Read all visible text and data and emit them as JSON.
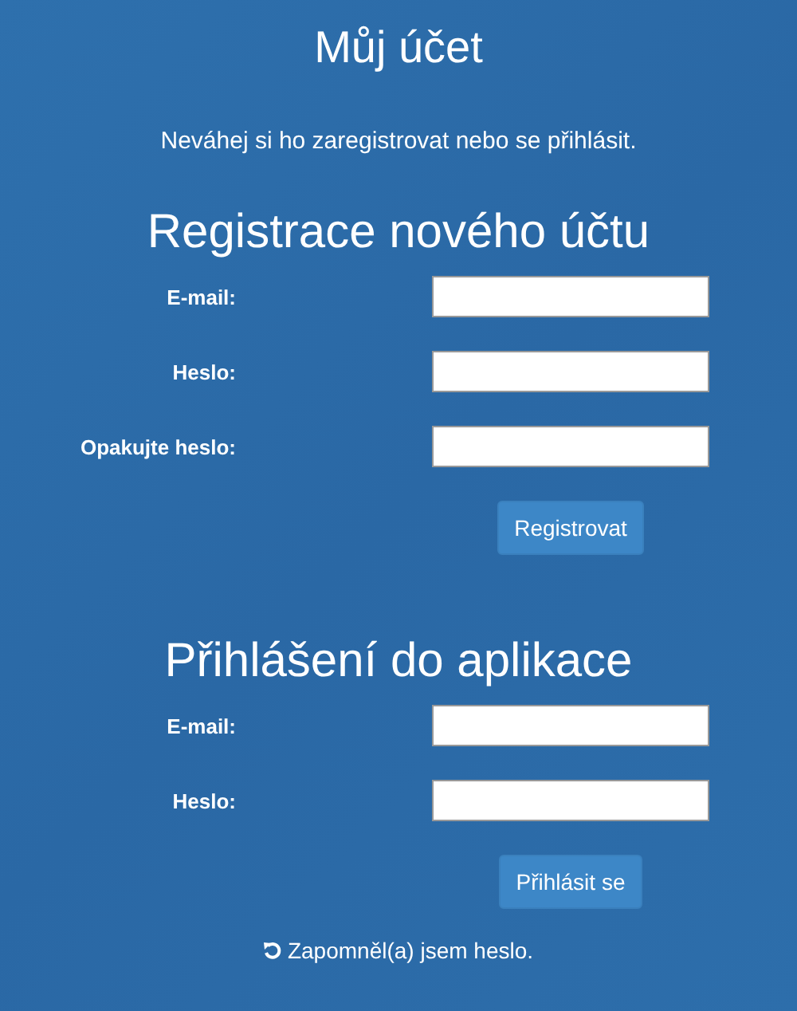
{
  "title": "Můj účet",
  "intro": "Neváhej si ho zaregistrovat nebo se přihlásit.",
  "sections": [
    {
      "heading": "Registrace nového účtu",
      "fields": [
        {
          "label": "E-mail:"
        },
        {
          "label": "Heslo:"
        },
        {
          "label": "Opakujte heslo:"
        }
      ],
      "button": "Registrovat"
    },
    {
      "heading": "Přihlášení do aplikace",
      "fields": [
        {
          "label": "E-mail:"
        },
        {
          "label": "Heslo:"
        }
      ],
      "button": "Přihlásit se"
    }
  ],
  "forgot_link": "Zapomněl(a) jsem heslo."
}
